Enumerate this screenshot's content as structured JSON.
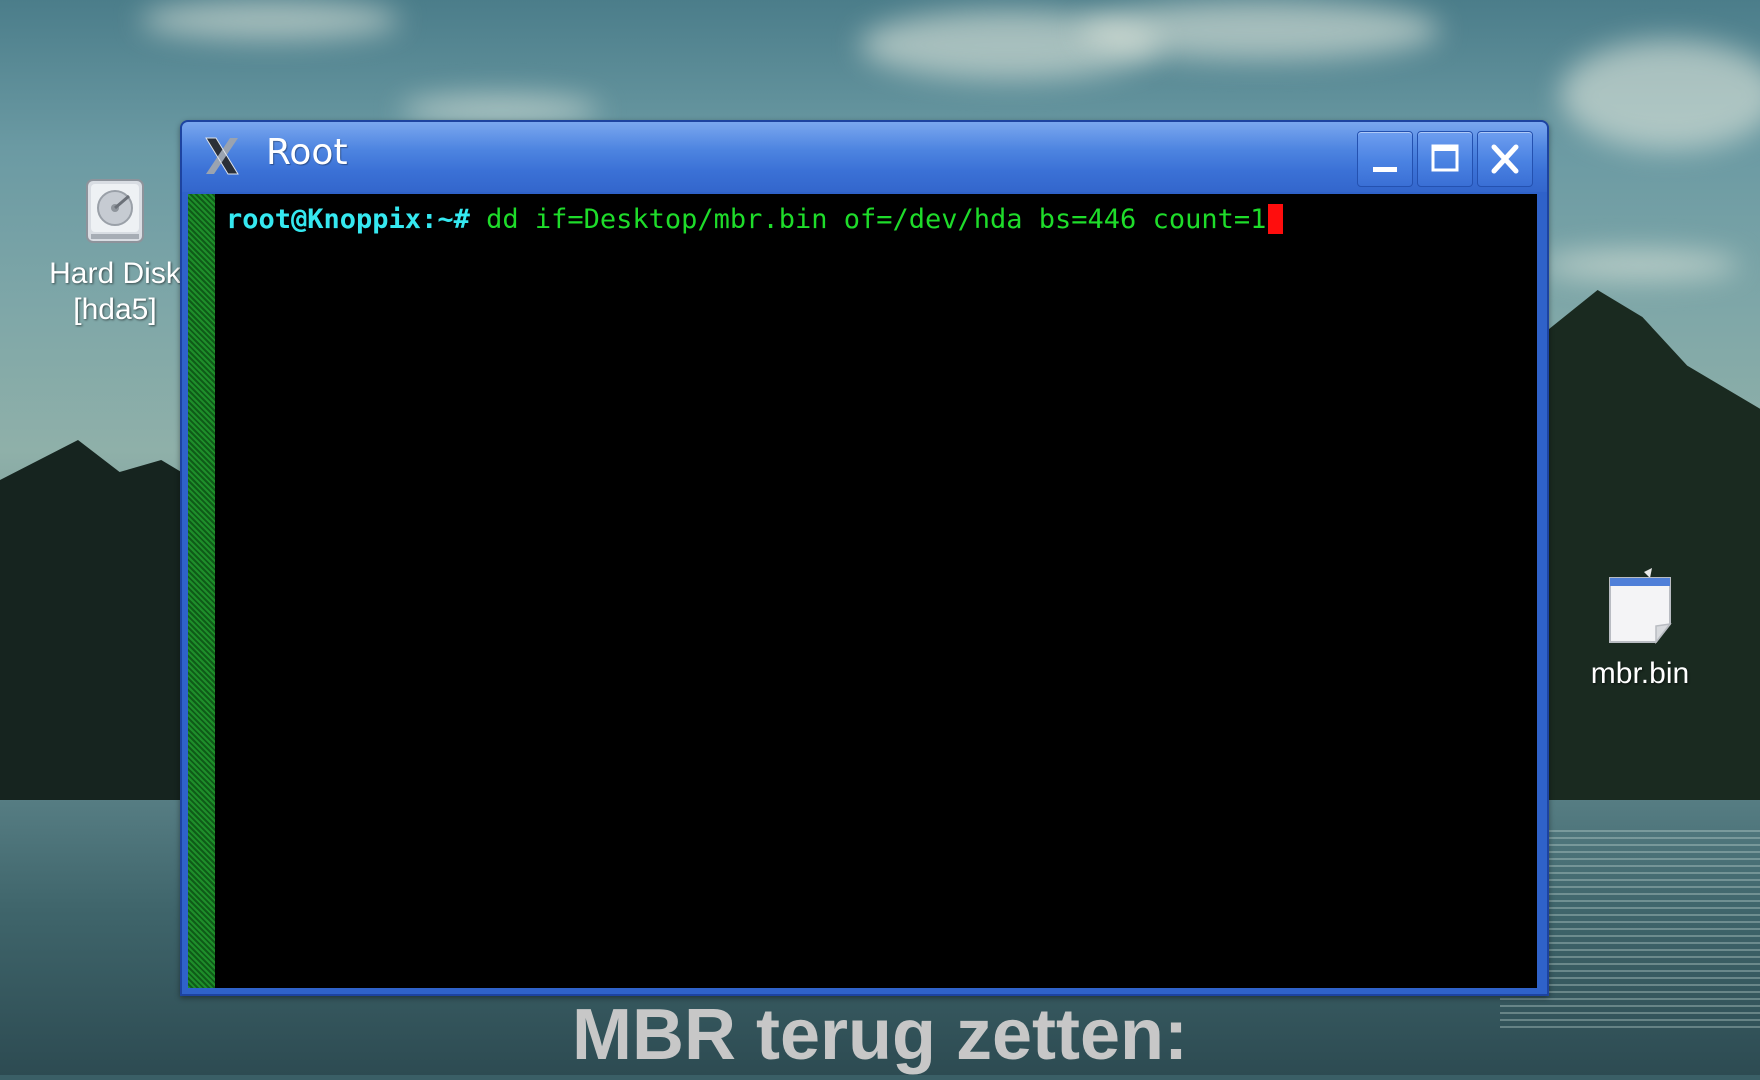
{
  "desktop": {
    "icons": [
      {
        "id": "hard-disk",
        "label_line1": "Hard Disk",
        "label_line2": "[hda5]",
        "icon": "hard-disk-icon"
      },
      {
        "id": "mbr-file",
        "label": "mbr.bin",
        "icon": "document-icon"
      }
    ]
  },
  "window": {
    "title": "Root",
    "app_icon": "x-icon",
    "controls": {
      "minimize": "minimize-icon",
      "maximize": "maximize-icon",
      "close": "close-icon"
    },
    "colors": {
      "titlebar": "#3b71d6",
      "border": "#1d43a0"
    }
  },
  "terminal": {
    "prompt": "root@Knoppix:~#",
    "command": " dd if=Desktop/mbr.bin of=/dev/hda bs=446 count=1",
    "colors": {
      "background": "#000000",
      "prompt": "#35e8f0",
      "command": "#1edc2a",
      "cursor": "#ff0d0d",
      "scrollbar": "#1e8e2a"
    }
  },
  "caption": "MBR terug zetten:"
}
